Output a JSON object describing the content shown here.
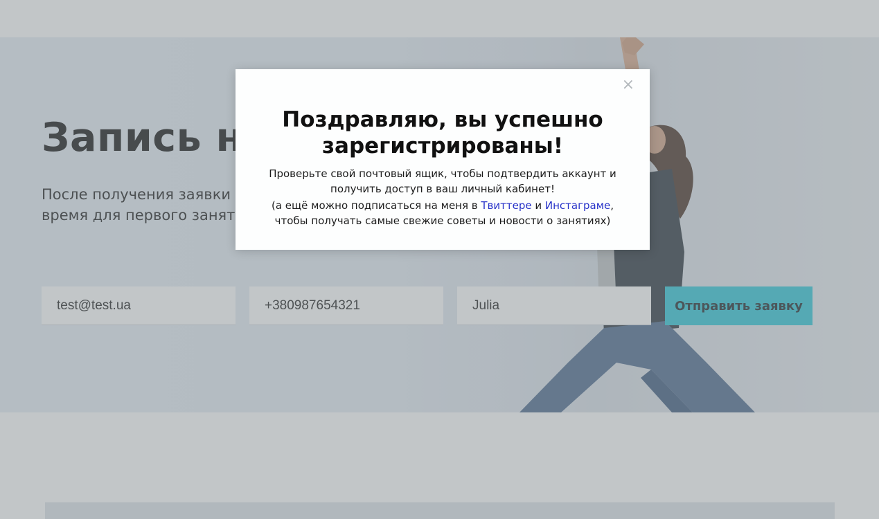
{
  "hero": {
    "title": "Запись на занятие",
    "text": "После получения заявки я свяжусь с вами, чтобы выбрать удобное время для первого занятия и начать практику"
  },
  "form": {
    "email_value": "test@test.ua",
    "phone_value": "+380987654321",
    "name_value": "Julia",
    "submit_label": "Отправить заявку"
  },
  "modal": {
    "close_glyph": "×",
    "title": "Поздравляю, вы успешно зарегистрированы!",
    "message": "Проверьте свой почтовый ящик, чтобы подтвердить аккаунт и получить доступ в ваш личный кабинет!",
    "social_prefix": "(а ещё можно подписаться на меня в ",
    "twitter_link": "Твиттере",
    "and_word": " и ",
    "instagram_link": "Инстаграме",
    "social_suffix": ", чтобы получать самые свежие советы и новости о занятиях)"
  },
  "colors": {
    "accent": "#2fc7d9",
    "link": "#2530c8",
    "overlay": "rgba(128,136,140,0.48)"
  }
}
